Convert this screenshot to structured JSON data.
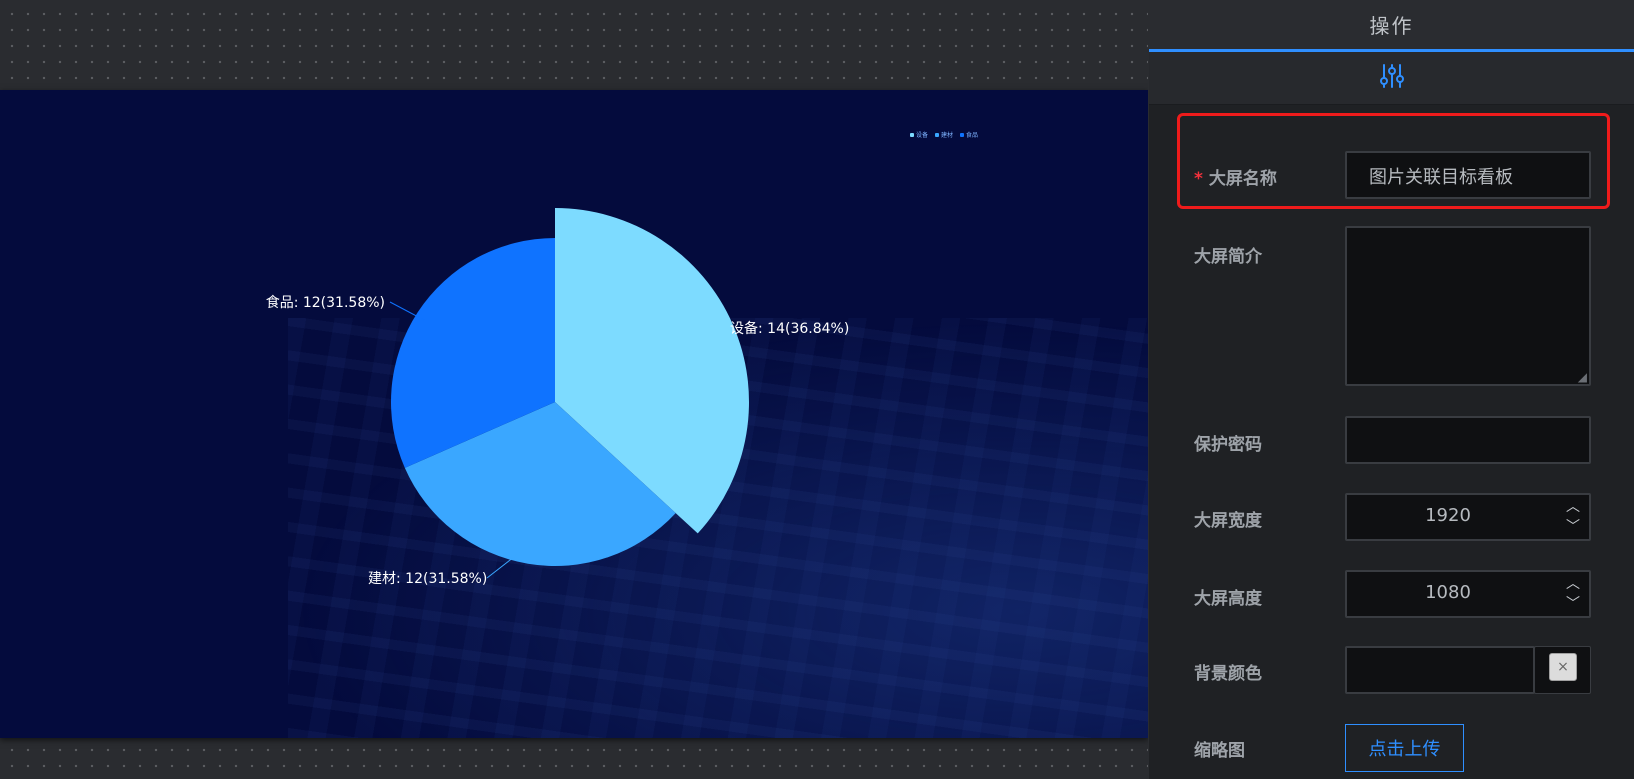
{
  "panel": {
    "title": "操作",
    "tab_icon": "sliders-icon"
  },
  "form": {
    "name_label": "大屏名称",
    "name_required": "*",
    "name_value": "图片关联目标看板",
    "desc_label": "大屏简介",
    "desc_value": "",
    "password_label": "保护密码",
    "password_value": "",
    "width_label": "大屏宽度",
    "width_value": "1920",
    "height_label": "大屏高度",
    "height_value": "1080",
    "bg_label": "背景颜色",
    "bg_clear": "×",
    "thumb_label": "缩略图",
    "upload_label": "点击上传",
    "step_up": "︿",
    "step_down": "﹀"
  },
  "chart_data": {
    "type": "pie",
    "title": "",
    "legend_position": "top-right",
    "slices": [
      {
        "name": "设备",
        "value": 14,
        "percent": 36.84,
        "label": "设备: 14(36.84%)",
        "color": "#7ddbff"
      },
      {
        "name": "建材",
        "value": 12,
        "percent": 31.58,
        "label": "建材: 12(31.58%)",
        "color": "#3aa7ff"
      },
      {
        "name": "食品",
        "value": 12,
        "percent": 31.58,
        "label": "食品: 12(31.58%)",
        "color": "#0f73ff"
      }
    ]
  },
  "colors": {
    "accent": "#2f8fff",
    "required": "#f5313d",
    "highlight": "#ef1b1b"
  }
}
